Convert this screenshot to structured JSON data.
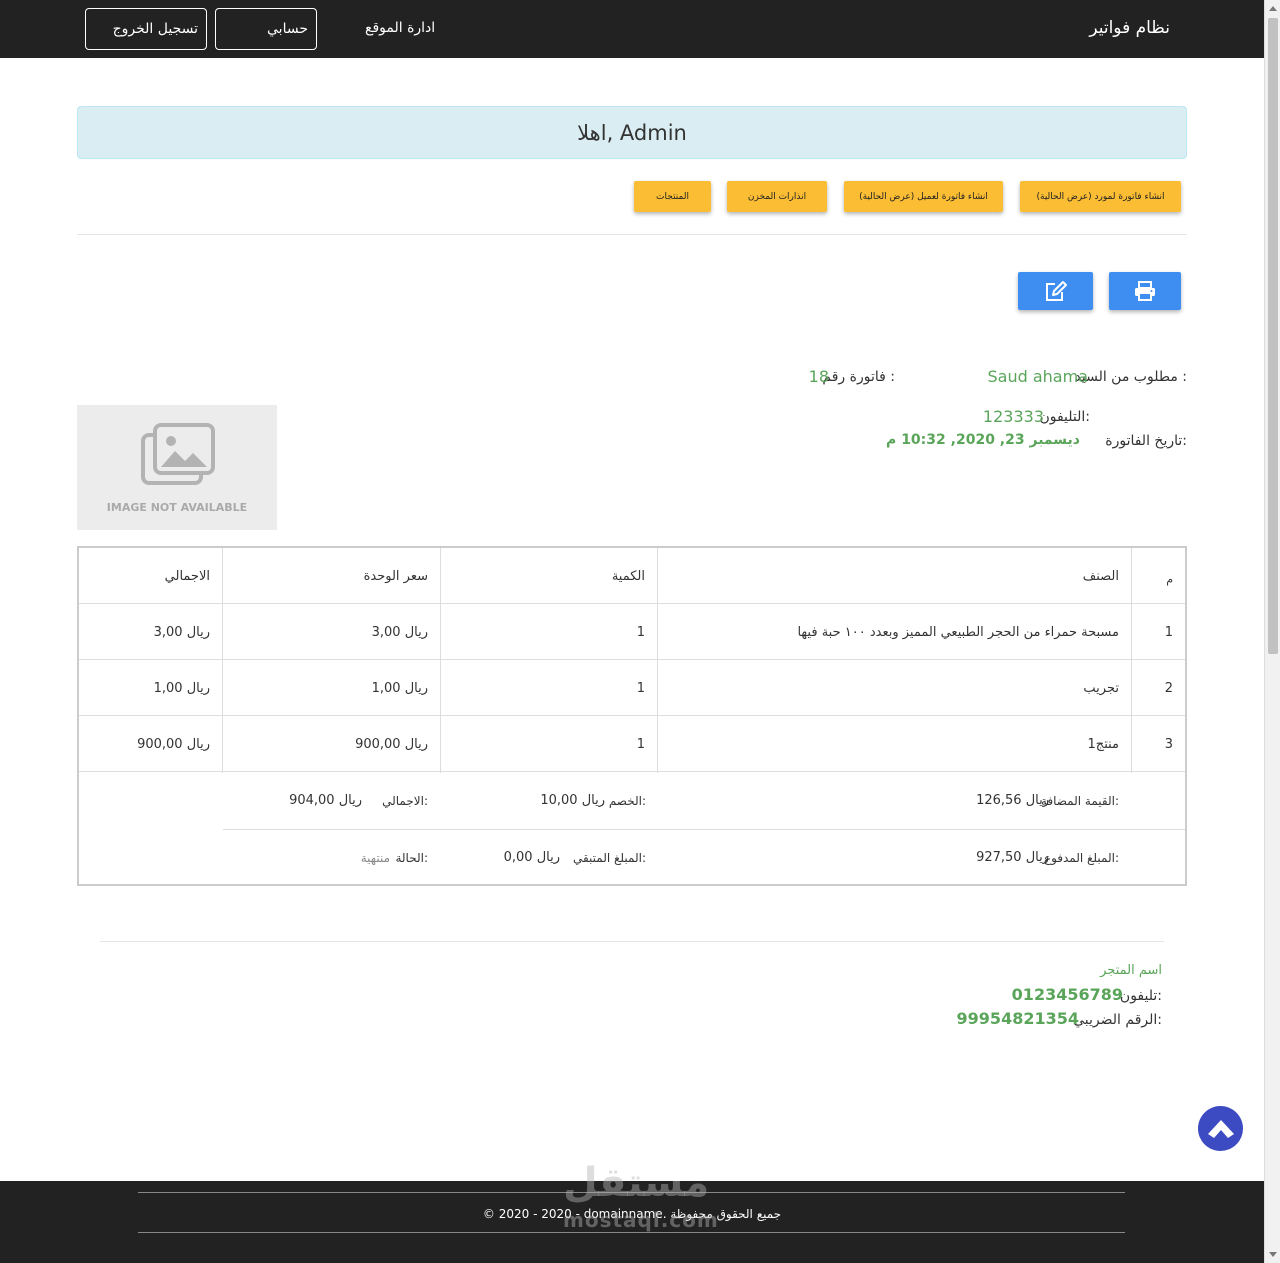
{
  "navbar": {
    "brand": "نظام فواتير",
    "site_admin": "ادارة الموقع",
    "account": "حسابي",
    "logout": "تسجيل الخروج"
  },
  "welcome": "اهلا, Admin",
  "actions": {
    "supplier_invoice": "انشاء فاتورة لمورد (عرض الحالية)",
    "client_invoice": "انشاء فاتورة لعميل (عرض الحالية)",
    "stock_alerts": "انذارات المخزن",
    "products": "المنتجات"
  },
  "invoice": {
    "requested_from_label": "مطلوب من السيد :",
    "customer_name": "Saud ahama",
    "invoice_no_label": "فاتورة رقم :",
    "invoice_no": "18",
    "phone_label": "التليفون:",
    "phone": "123333",
    "date_label": "تاريخ الفاتورة:",
    "date": "ديسمبر 23, 2020, 10:32 م",
    "image_placeholder": "IMAGE NOT AVAILABLE"
  },
  "table": {
    "headers": [
      "م",
      "الصنف",
      "الكمية",
      "سعر الوحدة",
      "الاجمالي"
    ],
    "rows": [
      {
        "no": "1",
        "item": "مسبحة حمراء من الحجر الطبيعي المميز وبعدد ١٠٠ حبة فيها",
        "qty": "1",
        "price": "ريال 3,00",
        "total": "ريال 3,00"
      },
      {
        "no": "2",
        "item": "تجريب",
        "qty": "1",
        "price": "ريال 1,00",
        "total": "ريال 1,00"
      },
      {
        "no": "3",
        "item": "منتج1",
        "qty": "1",
        "price": "ريال 900,00",
        "total": "ريال 900,00"
      }
    ]
  },
  "summary": {
    "vat_label": "القيمة المضافة:",
    "vat": "ريال 126,56",
    "discount_label": "الخصم:",
    "discount": "ريال 10,00",
    "total_label": "الاجمالي:",
    "total": "ريال 904,00",
    "paid_label": "المبلغ المدفوع:",
    "paid": "ريال 927,50",
    "remaining_label": "المبلغ المتبقي:",
    "remaining": "ريال 0,00",
    "status_label": "الحالة:",
    "status": "منتهية"
  },
  "store": {
    "name": "اسم المتجر",
    "phone_label": "تليفون:",
    "phone": "0123456789",
    "tax_label": "الرقم الضريبي:",
    "tax_no": "99954821354"
  },
  "footer": {
    "copyright": "© 2020 - 2020 - domainname. جميع الحقوق محفوظة"
  },
  "watermark": {
    "text": "مستقل",
    "sub": "mostaql.com"
  },
  "colors": {
    "accent_blue": "#3d8ef0",
    "action_yellow": "#fbbd34",
    "value_green": "#5aa55a",
    "navbar": "#222222"
  }
}
